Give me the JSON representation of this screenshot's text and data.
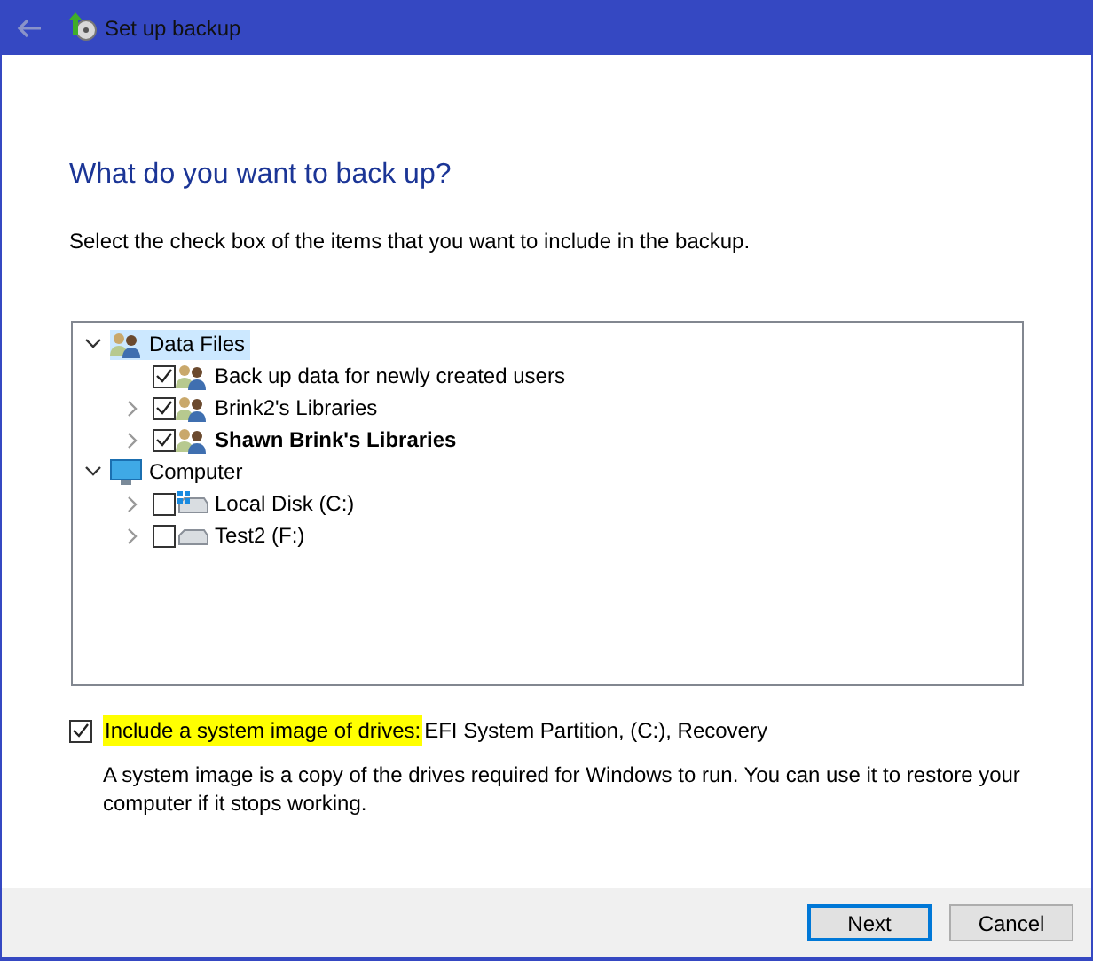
{
  "window": {
    "title": "Set up backup"
  },
  "heading": "What do you want to back up?",
  "instruction": "Select the check box of the items that you want to include in the backup.",
  "tree": [
    {
      "label": "Data Files",
      "kind": "users",
      "expanded": true,
      "selected": true,
      "children": [
        {
          "label": "Back up data for newly created users",
          "kind": "users",
          "checked": true,
          "selected": false
        },
        {
          "label": "Brink2's Libraries",
          "kind": "users",
          "checked": true,
          "expanded": false,
          "selected": false
        },
        {
          "label": "Shawn Brink's Libraries",
          "kind": "users",
          "checked": true,
          "expanded": false,
          "bold": true,
          "selected": false
        }
      ]
    },
    {
      "label": "Computer",
      "kind": "computer",
      "expanded": true,
      "selected": false,
      "children": [
        {
          "label": "Local Disk (C:)",
          "kind": "system-drive",
          "checked": false,
          "expanded": false,
          "selected": false
        },
        {
          "label": "Test2 (F:)",
          "kind": "drive",
          "checked": false,
          "expanded": false,
          "selected": false
        }
      ]
    }
  ],
  "system_image": {
    "checked": true,
    "label": "Include a system image of drives:",
    "highlighted": true,
    "drives": "EFI System Partition, (C:), Recovery",
    "description": "A system image is a copy of the drives required for Windows to run. You can use it to restore your computer if it stops working."
  },
  "buttons": [
    {
      "label": "Next",
      "default": true
    },
    {
      "label": "Cancel",
      "default": false
    }
  ]
}
